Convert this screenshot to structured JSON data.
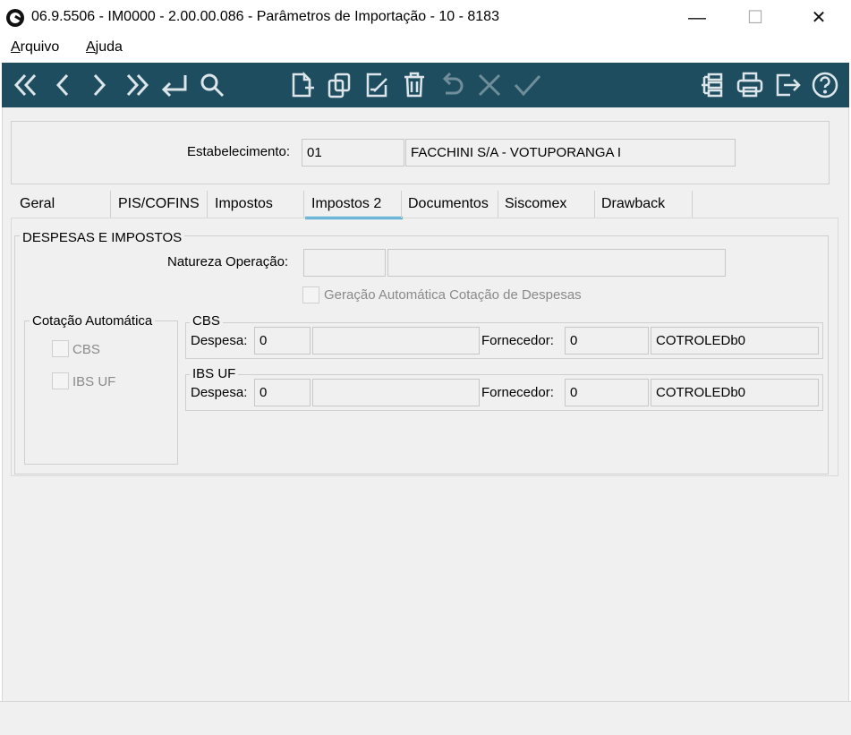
{
  "window": {
    "title": "06.9.5506 - IM0000 - 2.00.00.086 - Parâmetros de Importação - 10 - 8183",
    "minimize_glyph": "—",
    "maximize_glyph": "☐",
    "close_glyph": "✕"
  },
  "menu": {
    "items": [
      {
        "label_underlined": "A",
        "label_rest": "rquivo"
      },
      {
        "label_underlined": "A",
        "label_rest": "juda"
      }
    ]
  },
  "toolbar": {
    "background": "#1e4d5f",
    "icons": [
      "first-icon",
      "prev-icon",
      "next-icon",
      "last-icon",
      "return-icon",
      "search-icon",
      "new-icon",
      "copy-icon",
      "edit-icon",
      "delete-icon",
      "undo-icon",
      "cancel-icon",
      "confirm-icon",
      "tree-icon",
      "print-icon",
      "exit-icon",
      "help-icon"
    ]
  },
  "header": {
    "estabelecimento_label": "Estabelecimento:",
    "estabelecimento_code": "01",
    "estabelecimento_name": "FACCHINI S/A - VOTUPORANGA I"
  },
  "tabs": [
    {
      "label": "Geral"
    },
    {
      "label": "PIS/COFINS"
    },
    {
      "label": "Impostos"
    },
    {
      "label": "Impostos 2",
      "active": true
    },
    {
      "label": "Documentos"
    },
    {
      "label": "Siscomex"
    },
    {
      "label": "Drawback"
    }
  ],
  "active_tab_color": "#1b9ad6",
  "despesas": {
    "title": "DESPESAS E IMPOSTOS",
    "natureza_label": "Natureza Operação:",
    "natureza_code": "",
    "natureza_desc": "",
    "geracao_label": "Geração Automática Cotação de Despesas",
    "cotacao": {
      "title": "Cotação Automática",
      "cbs_label": "CBS",
      "ibsuf_label": "IBS UF"
    },
    "cbs": {
      "title": "CBS",
      "despesa_label": "Despesa:",
      "despesa_code": "0",
      "despesa_desc": "",
      "fornecedor_label": "Fornecedor:",
      "fornecedor_code": "0",
      "fornecedor_name": "COTROLEDb0"
    },
    "ibsuf": {
      "title": "IBS UF",
      "despesa_label": "Despesa:",
      "despesa_code": "0",
      "despesa_desc": "",
      "fornecedor_label": "Fornecedor:",
      "fornecedor_code": "0",
      "fornecedor_name": "COTROLEDb0"
    }
  }
}
